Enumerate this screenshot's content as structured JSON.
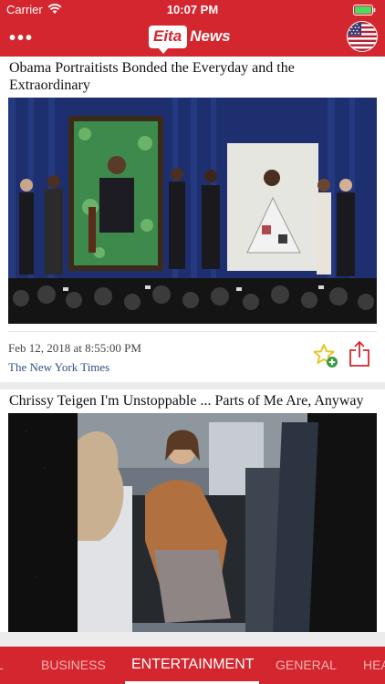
{
  "status_bar": {
    "carrier": "Carrier",
    "time": "10:07 PM"
  },
  "header": {
    "logo_badge": "Eita",
    "logo_word": "News",
    "menu_icon": "more-dots-icon",
    "flag_icon": "us-flag-icon"
  },
  "colors": {
    "brand_red": "#d4262e",
    "link_blue": "#2e4f88",
    "star_yellow": "#e9c42a",
    "plus_green": "#3a9b3f"
  },
  "articles": [
    {
      "title": "Obama Portraitists Bonded the Everyday and the Extraordinary",
      "date": "Feb 12, 2018 at 8:55:00 PM",
      "source": "The New York Times"
    },
    {
      "title": "Chrissy Teigen I'm Unstoppable ... Parts of Me Are, Anyway"
    }
  ],
  "tabs": [
    {
      "label": "L"
    },
    {
      "label": "BUSINESS"
    },
    {
      "label": "ENTERTAINMENT",
      "active": true
    },
    {
      "label": "GENERAL"
    },
    {
      "label": "HEA"
    }
  ]
}
